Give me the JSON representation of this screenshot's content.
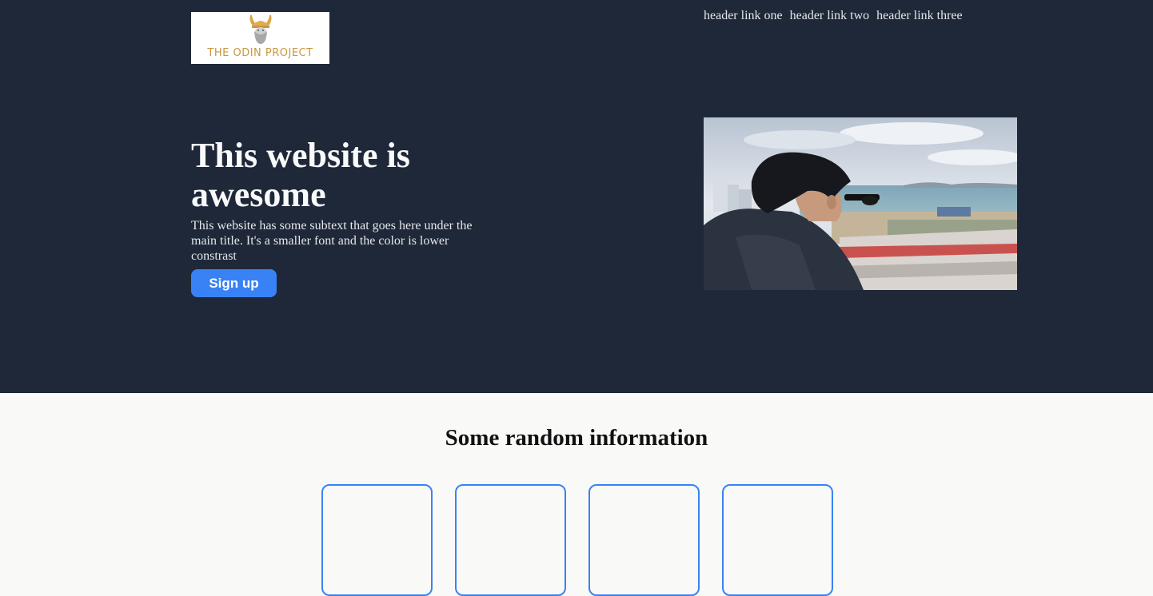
{
  "header": {
    "logo": {
      "text": "THE ODIN PROJECT",
      "icon": "viking-helmet-icon",
      "color": "#c9973f"
    },
    "nav_links": [
      "header link one",
      "header link two",
      "header link three"
    ]
  },
  "hero": {
    "title": "This website is awesome",
    "subtext": "This website has some subtext that goes here under the main title. It's a smaller font and the color is lower constrast",
    "signup_label": "Sign up",
    "image": "photo-person-looking-at-sea"
  },
  "info": {
    "heading": "Some random information",
    "card_count": 4
  },
  "colors": {
    "hero_bg": "#1f2838",
    "accent": "#3882f6",
    "page_bg": "#f9f9f7"
  }
}
